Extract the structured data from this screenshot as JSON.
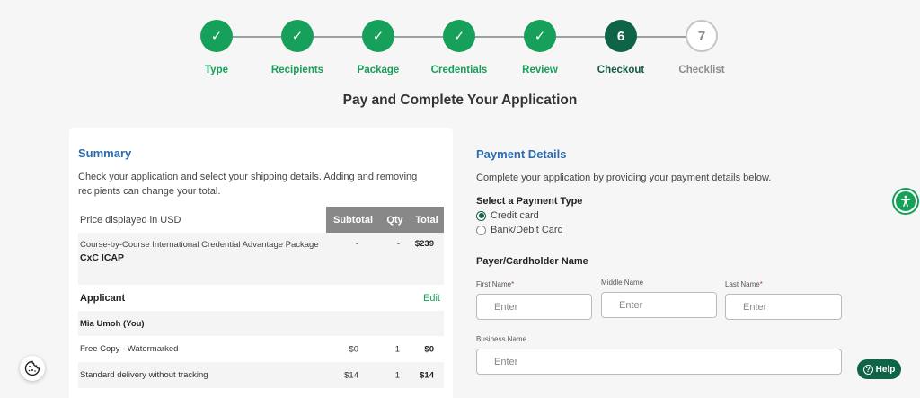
{
  "stepper": {
    "steps": [
      {
        "label": "Type",
        "symbol": "✓",
        "state": "done"
      },
      {
        "label": "Recipients",
        "symbol": "✓",
        "state": "done"
      },
      {
        "label": "Package",
        "symbol": "✓",
        "state": "done"
      },
      {
        "label": "Credentials",
        "symbol": "✓",
        "state": "done"
      },
      {
        "label": "Review",
        "symbol": "✓",
        "state": "done"
      },
      {
        "label": "Checkout",
        "symbol": "6",
        "state": "current"
      },
      {
        "label": "Checklist",
        "symbol": "7",
        "state": "todo"
      }
    ]
  },
  "page_title": "Pay and Complete Your Application",
  "summary": {
    "title": "Summary",
    "description": "Check your application and select your shipping details. Adding and removing recipients can change your total.",
    "price_label": "Price displayed in USD",
    "columns": {
      "subtotal": "Subtotal",
      "qty": "Qty",
      "total": "Total"
    },
    "package": {
      "description": "Course-by-Course International Credential Advantage Package",
      "code": "CxC ICAP",
      "subtotal": "-",
      "qty": "-",
      "total": "$239"
    },
    "applicant_heading": "Applicant",
    "edit_label": "Edit",
    "applicant_name": "Mia Umoh (You)",
    "lines": [
      {
        "label": "Free Copy - Watermarked",
        "subtotal": "$0",
        "qty": "1",
        "total": "$0"
      },
      {
        "label": "Standard delivery without tracking",
        "subtotal": "$14",
        "qty": "1",
        "total": "$14"
      }
    ]
  },
  "payment": {
    "title": "Payment Details",
    "description": "Complete your application by providing your payment details below.",
    "type_heading": "Select a Payment Type",
    "options": [
      {
        "label": "Credit card",
        "selected": true
      },
      {
        "label": "Bank/Debit Card",
        "selected": false
      }
    ],
    "payer_heading": "Payer/Cardholder Name",
    "fields": {
      "first_name": {
        "label": "First Name",
        "required": "*",
        "placeholder": "Enter"
      },
      "middle_name": {
        "label": "Middle Name",
        "required": "",
        "placeholder": "Enter"
      },
      "last_name": {
        "label": "Last Name",
        "required": "*",
        "placeholder": "Enter"
      },
      "business_name": {
        "label": "Business Name",
        "required": "",
        "placeholder": "Enter"
      }
    }
  },
  "help_label": "Help",
  "colors": {
    "accent_green": "#16a05a",
    "dark_green": "#0f6447",
    "heading_blue": "#2b6cb0"
  }
}
